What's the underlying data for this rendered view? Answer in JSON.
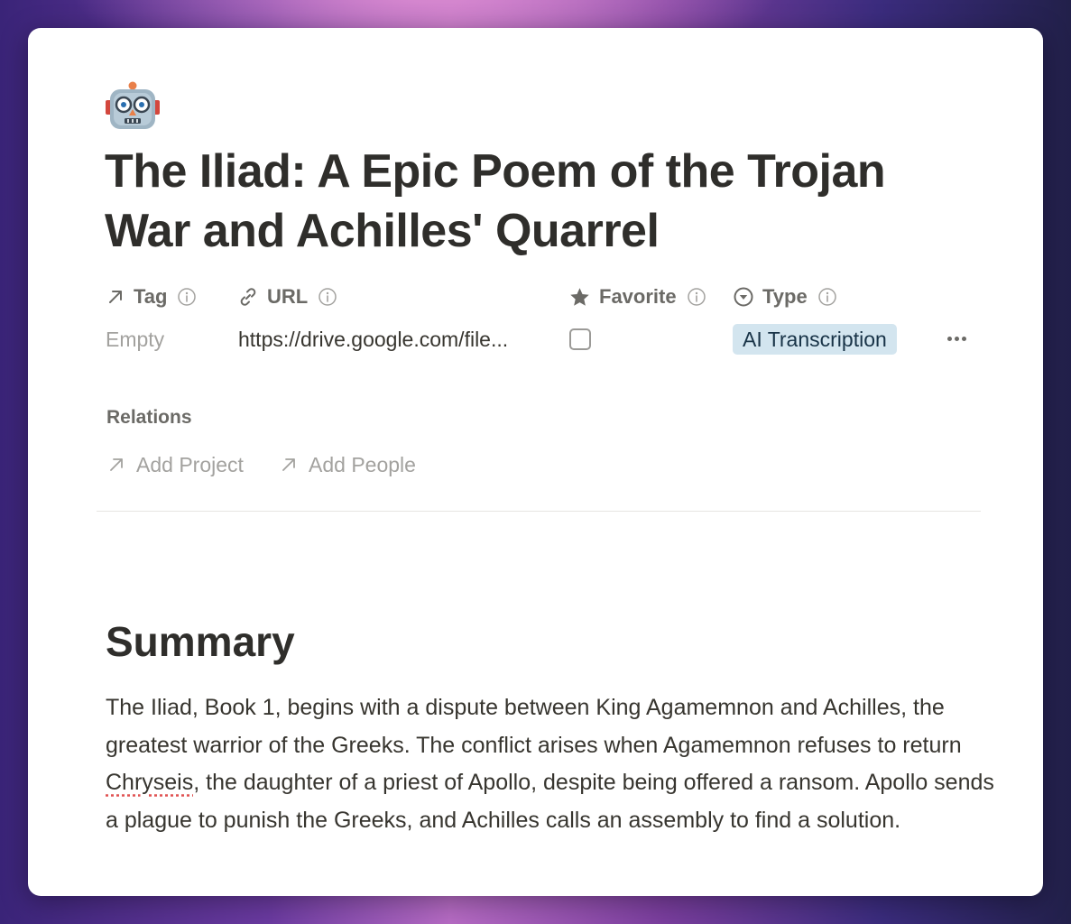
{
  "page": {
    "icon": "robot-face-icon",
    "title": "The Iliad: A Epic Poem of the Trojan War and Achilles' Quarrel"
  },
  "properties": {
    "tag": {
      "label": "Tag",
      "icon": "arrow-up-right-icon",
      "value": "Empty"
    },
    "url": {
      "label": "URL",
      "icon": "link-icon",
      "value": "https://drive.google.com/file..."
    },
    "favorite": {
      "label": "Favorite",
      "icon": "star-icon",
      "checked": false
    },
    "type": {
      "label": "Type",
      "icon": "select-icon",
      "value": "AI Transcription",
      "badge_color": "#d3e5ef"
    }
  },
  "relations": {
    "label": "Relations",
    "items": [
      {
        "label": "Add Project",
        "icon": "arrow-up-right-icon"
      },
      {
        "label": "Add People",
        "icon": "arrow-up-right-icon"
      }
    ]
  },
  "summary": {
    "heading": "Summary",
    "body_before": "The Iliad, Book 1, begins with a dispute between King Agamemnon and Achilles, the greatest warrior of the Greeks. The conflict arises when Agamemnon refuses to return ",
    "misspelled_word": "Chryseis",
    "body_after": ", the daughter of a priest of Apollo, despite being offered a ransom. Apollo sends a plague to punish the Greeks, and Achilles calls an assembly to find a solution."
  }
}
